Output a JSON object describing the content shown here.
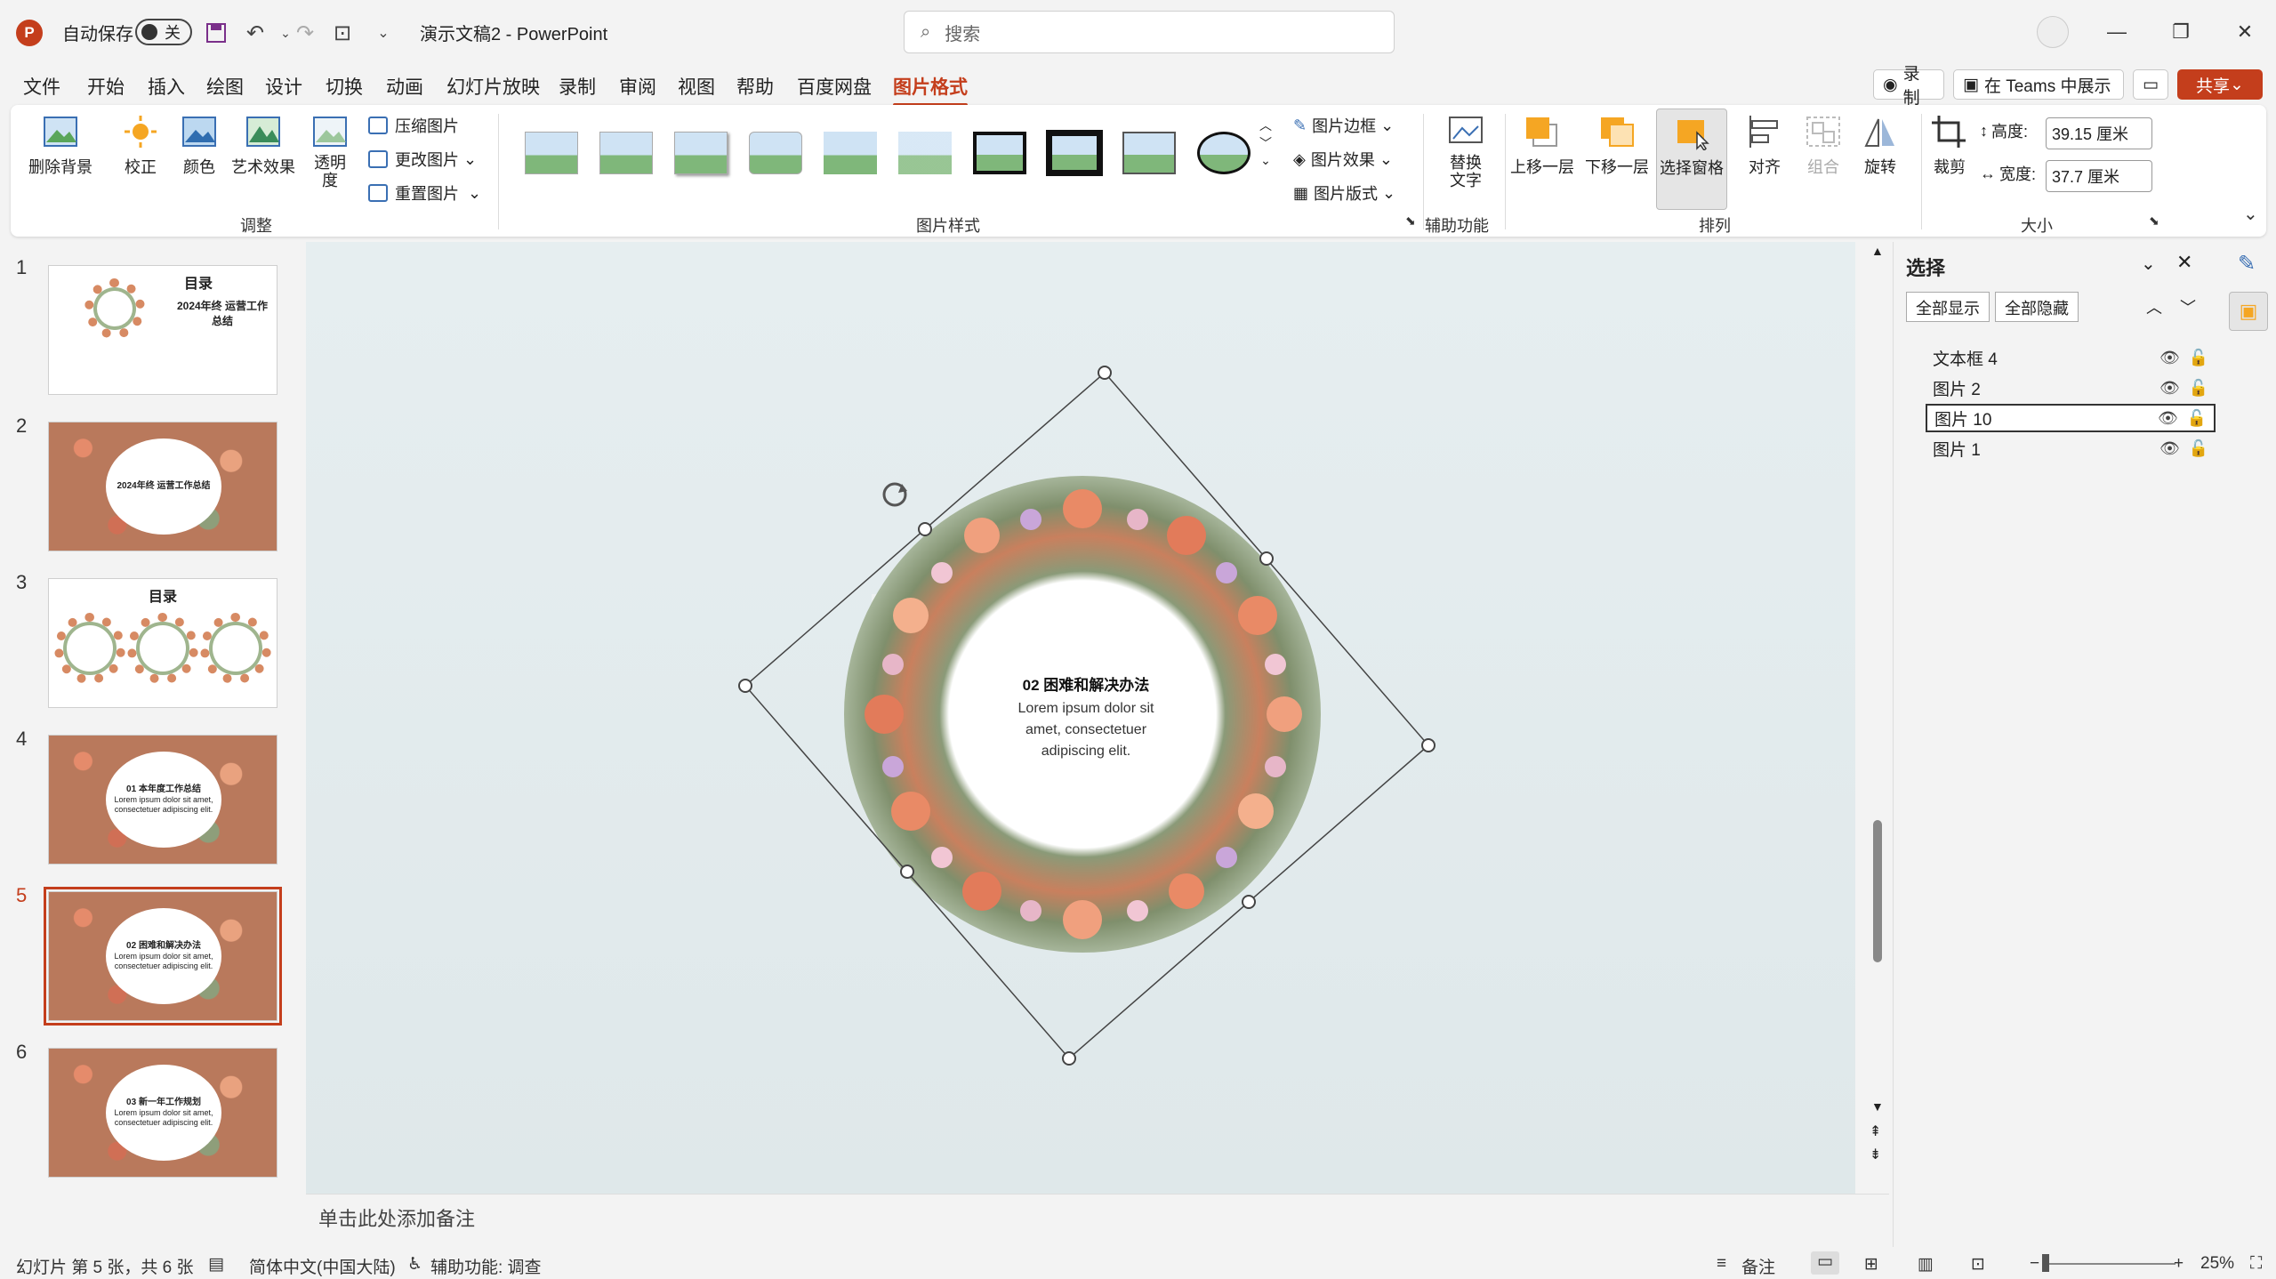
{
  "app": {
    "logo_letter": "P",
    "autosave_label": "自动保存",
    "autosave_state": "关",
    "doc_title": "演示文稿2  -  PowerPoint"
  },
  "search": {
    "placeholder": "搜索"
  },
  "menu": {
    "tabs": [
      "文件",
      "开始",
      "插入",
      "绘图",
      "设计",
      "切换",
      "动画",
      "幻灯片放映",
      "录制",
      "审阅",
      "视图",
      "帮助",
      "百度网盘",
      "图片格式"
    ],
    "active": "图片格式",
    "record": "录制",
    "teams": "在 Teams 中展示",
    "share": "共享"
  },
  "ribbon": {
    "adjust": {
      "remove_bg": "删除背景",
      "correct": "校正",
      "color": "颜色",
      "art": "艺术效果",
      "transparency": "透明度",
      "compress": "压缩图片",
      "change": "更改图片",
      "reset": "重置图片",
      "label": "调整"
    },
    "styles": {
      "label": "图片样式",
      "border": "图片边框",
      "effects": "图片效果",
      "layout": "图片版式"
    },
    "accessibility": {
      "alt_text": "替换文字",
      "label": "辅助功能"
    },
    "arrange": {
      "forward": "上移一层",
      "backward": "下移一层",
      "selection_pane": "选择窗格",
      "align": "对齐",
      "group": "组合",
      "rotate": "旋转",
      "label": "排列"
    },
    "size": {
      "crop": "裁剪",
      "height_label": "高度:",
      "height_value": "39.15 厘米",
      "width_label": "宽度:",
      "width_value": "37.7 厘米",
      "label": "大小"
    }
  },
  "slides": [
    {
      "num": "1",
      "title": "目录",
      "subtitle": "2024年终 运营工作总结"
    },
    {
      "num": "2",
      "title": "2024年终 运营工作总结"
    },
    {
      "num": "3",
      "title": "目录"
    },
    {
      "num": "4",
      "title": "01 本年度工作总结",
      "body": "Lorem ipsum dolor sit amet, consectetuer adipiscing elit."
    },
    {
      "num": "5",
      "title": "02 困难和解决办法",
      "body": "Lorem ipsum dolor sit amet, consectetuer adipiscing elit."
    },
    {
      "num": "6",
      "title": "03 新一年工作规划",
      "body": "Lorem ipsum dolor sit amet, consectetuer adipiscing elit."
    }
  ],
  "current_slide": {
    "heading": "02 困难和解决办法",
    "body_line1": "Lorem ipsum dolor sit",
    "body_line2": "amet, consectetuer",
    "body_line3": "adipiscing elit."
  },
  "notes": {
    "placeholder": "单击此处添加备注"
  },
  "selection_pane": {
    "title": "选择",
    "show_all": "全部显示",
    "hide_all": "全部隐藏",
    "items": [
      "文本框 4",
      "图片 2",
      "图片 10",
      "图片 1"
    ],
    "selected": "图片 10"
  },
  "status": {
    "slide_info": "幻灯片 第 5 张，共 6 张",
    "language": "简体中文(中国大陆)",
    "accessibility": "辅助功能: 调查",
    "notes": "备注",
    "zoom": "25%"
  },
  "colors": {
    "accent": "#c43e1c",
    "canvas": "#e3ecee"
  }
}
